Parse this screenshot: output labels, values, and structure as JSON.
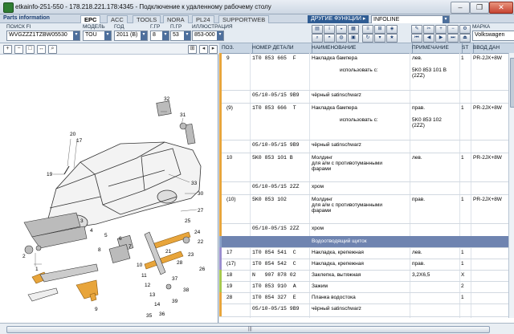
{
  "window": {
    "title": "etkainfo-251-550 - 178.218.221.178:4345 - Подключение к удаленному рабочему столу",
    "buttons": {
      "minimize": "–",
      "restore": "❐",
      "close": "✕"
    }
  },
  "app": {
    "parts_info_label": "Parts information",
    "tabs": [
      "EPC",
      "ACC",
      "TOOLS",
      "NORA",
      "PL24",
      "SUPPORTWEB"
    ],
    "active_tab": "EPC",
    "other_functions": "ДРУГИЕ ФУНКЦИИ",
    "infoline": "INFOLINE"
  },
  "selectors": {
    "vin": {
      "label": "ПОИСК FI",
      "value": "WVGZZZ1TZBW05530"
    },
    "model": {
      "label": "МОДЕЛЬ",
      "value": "TOU"
    },
    "year": {
      "label": "ГОД",
      "value": "2011 (B)"
    },
    "mgroup": {
      "label": "Г.ГР",
      "value": "8"
    },
    "subgroup": {
      "label": "П.ГР",
      "value": "53"
    },
    "illustration": {
      "label": "ИЛЛЮСТРАЦИЯ",
      "value": "853-000"
    },
    "brand": {
      "label": "МАРКА",
      "value": "Volkswagen"
    }
  },
  "diagram": {
    "callouts": [
      "20",
      "17",
      "19",
      "32",
      "31",
      "33",
      "30",
      "27",
      "25",
      "24",
      "22",
      "21",
      "23",
      "28",
      "26",
      "1",
      "2",
      "3",
      "4",
      "5",
      "6",
      "7",
      "8",
      "9",
      "10",
      "11",
      "12",
      "13",
      "14",
      "35",
      "36",
      "37",
      "38",
      "39"
    ],
    "accent_color": "#e8a53b"
  },
  "table": {
    "columns": [
      "ПОЗ.",
      "НОМЕР ДЕТАЛИ",
      "НАИМЕНОВАНИЕ",
      "ПРИМЕЧАНИЕ",
      "ST",
      "ВВОД ДАН"
    ],
    "rows": [
      {
        "pos": "9",
        "part": "1T0 853 665  F",
        "name": "Накладка бампера",
        "note": "лев.",
        "st": "1",
        "data": "PR-2JX+8W",
        "sub": "использовать с:",
        "sub_note": "5K0 853 101 B\n(2ZZ)",
        "color": "#e8a53b"
      },
      {
        "pos": "",
        "part": "05/10-05/15 9B9",
        "name": "чёрный satinschwarz",
        "note": "",
        "st": "",
        "data": "",
        "color": "#e8a53b"
      },
      {
        "pos": "(9)",
        "part": "1T0 853 666  T",
        "name": "Накладка бампера",
        "note": "прав.",
        "st": "1",
        "data": "PR-2JX+8W",
        "sub": "использовать с:",
        "sub_note": "5K0 853 102\n(2ZZ)",
        "color": "#e8a53b"
      },
      {
        "pos": "",
        "part": "05/10-05/15 9B9",
        "name": "чёрный satinschwarz",
        "note": "",
        "st": "",
        "data": "",
        "color": "#e8a53b"
      },
      {
        "pos": "10",
        "part": "5K0 853 101 B",
        "name": "Молдинг\nдля а/м с противотуманными\nфарами",
        "note": "лев.",
        "st": "1",
        "data": "PR-2JX+8W",
        "color": "#e8a53b"
      },
      {
        "pos": "",
        "part": "05/10-05/15 2ZZ",
        "name": "хром",
        "note": "",
        "st": "",
        "data": "",
        "color": "#e8a53b"
      },
      {
        "pos": "(10)",
        "part": "5K0 853 102",
        "name": "Молдинг\nдля а/м с противотуманными\nфарами",
        "note": "прав.",
        "st": "1",
        "data": "PR-2JX+8W",
        "color": "#e8a53b"
      },
      {
        "pos": "",
        "part": "05/10-05/15 2ZZ",
        "name": "хром",
        "note": "",
        "st": "",
        "data": "",
        "color": "#e8a53b"
      },
      {
        "pos": "",
        "part": "",
        "name": "Водоотводящий щиток",
        "note": "",
        "st": "",
        "data": "",
        "color": "#8aa2c8",
        "section": true
      },
      {
        "pos": "17",
        "part": "1T0 854 541  C",
        "name": "Накладка, крепежная",
        "note": "лев.",
        "st": "1",
        "data": "",
        "color": "#9b8ecf"
      },
      {
        "pos": "(17)",
        "part": "1T0 854 542  C",
        "name": "Накладка, крепежная",
        "note": "прав.",
        "st": "1",
        "data": "",
        "color": "#9b8ecf"
      },
      {
        "pos": "18",
        "part": "N   907 878 02",
        "name": "Заклепка, вытяжная",
        "note": "3,2X6,5",
        "st": "X",
        "data": "",
        "color": "#a7c84e"
      },
      {
        "pos": "19",
        "part": "1T0 853 910  A",
        "name": "Зажим",
        "note": "",
        "st": "2",
        "data": "",
        "color": "#a7c84e"
      },
      {
        "pos": "28",
        "part": "1T0 854 327  E",
        "name": "Планка водостока",
        "note": "",
        "st": "1",
        "data": "",
        "color": "#e8a53b"
      },
      {
        "pos": "",
        "part": "05/10-05/15 9B9",
        "name": "чёрный satinschwarz",
        "note": "",
        "st": "",
        "data": "",
        "color": "#e8a53b"
      }
    ]
  }
}
